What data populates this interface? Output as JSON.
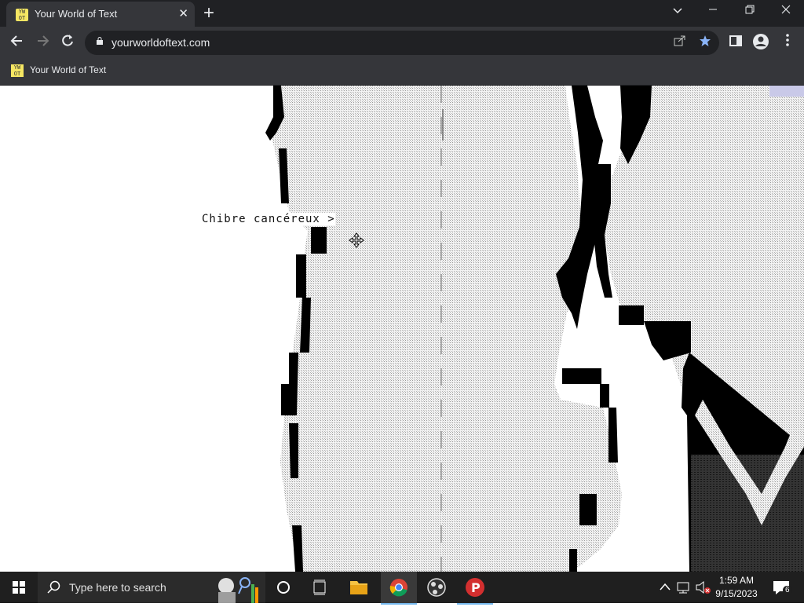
{
  "browser": {
    "tab_title": "Your World of Text",
    "tab_favicon": "YW OT",
    "close_tab_glyph": "✕",
    "new_tab_glyph": "+",
    "url": "yourworldoftext.com",
    "bookmark_label": "Your World of Text"
  },
  "page": {
    "world_text": "Chibre cancéreux >",
    "art_colors": {
      "dark": "#000000",
      "light": "#d9d9d9",
      "mid": "#8c8c8c",
      "bg": "#ffffff"
    }
  },
  "taskbar": {
    "search_placeholder": "Type here to search",
    "time": "1:59 AM",
    "date": "9/15/2023",
    "notification_count": "6"
  },
  "icons": [
    "windows-logo-icon",
    "search-icon",
    "cortana-icon",
    "task-view-icon",
    "file-explorer-icon",
    "chrome-icon",
    "obs-icon",
    "p-app-icon",
    "chevron-up-icon",
    "network-icon",
    "volume-muted-icon",
    "notification-icon",
    "move-cursor-icon",
    "lock-icon",
    "share-icon",
    "star-icon",
    "sidebar-icon",
    "profile-icon",
    "kebab-menu-icon"
  ]
}
